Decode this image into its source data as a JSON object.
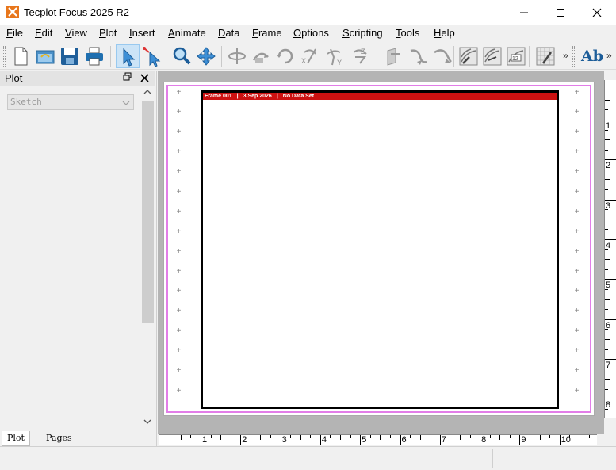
{
  "window": {
    "title": "Tecplot Focus 2025 R2",
    "minimize_glyph": "—",
    "maximize_glyph": "☐",
    "close_glyph": "✕"
  },
  "menu": [
    {
      "pre": "",
      "ul": "F",
      "post": "ile"
    },
    {
      "pre": "",
      "ul": "E",
      "post": "dit"
    },
    {
      "pre": "",
      "ul": "V",
      "post": "iew"
    },
    {
      "pre": "",
      "ul": "P",
      "post": "lot"
    },
    {
      "pre": "",
      "ul": "I",
      "post": "nsert"
    },
    {
      "pre": "",
      "ul": "A",
      "post": "nimate"
    },
    {
      "pre": "",
      "ul": "D",
      "post": "ata"
    },
    {
      "pre": "",
      "ul": "F",
      "post": "rame"
    },
    {
      "pre": "",
      "ul": "O",
      "post": "ptions"
    },
    {
      "pre": "",
      "ul": "S",
      "post": "cripting"
    },
    {
      "pre": "",
      "ul": "T",
      "post": "ools"
    },
    {
      "pre": "",
      "ul": "H",
      "post": "elp"
    }
  ],
  "toolbar": {
    "icons": [
      "new-file-icon",
      "open-file-icon",
      "save-icon",
      "print-icon",
      "select-pointer-icon",
      "adjustor-icon",
      "zoom-icon",
      "translate-icon",
      "rotate-spherical-icon",
      "rotate-rollerball-icon",
      "rotate-twist-icon",
      "rotate-x-icon",
      "rotate-y-icon",
      "rotate-z-icon",
      "slice-icon",
      "streamtrace-icon",
      "streamtrace-rake-icon",
      "contour-add-icon",
      "contour-remove-icon",
      "contour-label-icon",
      "zone-edit-icon",
      "text-icon"
    ],
    "overflow_glyph": "»",
    "text_tool_label": "Ab"
  },
  "panel": {
    "title": "Plot",
    "restore_glyph": "🗗",
    "close_glyph": "✕",
    "plot_type_value": "Sketch",
    "tabs": [
      "Plot",
      "Pages"
    ]
  },
  "frame": {
    "header": [
      "Frame 001",
      "3 Sep 2026",
      "No Data Set"
    ],
    "separator": "|"
  },
  "rulers": {
    "horizontal": [
      "1",
      "2",
      "3",
      "4",
      "5",
      "6",
      "7",
      "8",
      "9",
      "10"
    ],
    "vertical": [
      "1",
      "2",
      "3",
      "4",
      "5",
      "6",
      "7",
      "8"
    ]
  },
  "colors": {
    "frame_header": "#cc1111",
    "paper_border": "#e27de8",
    "workspace": "#b4b4b4",
    "selected_tool": "#cce4f7"
  }
}
